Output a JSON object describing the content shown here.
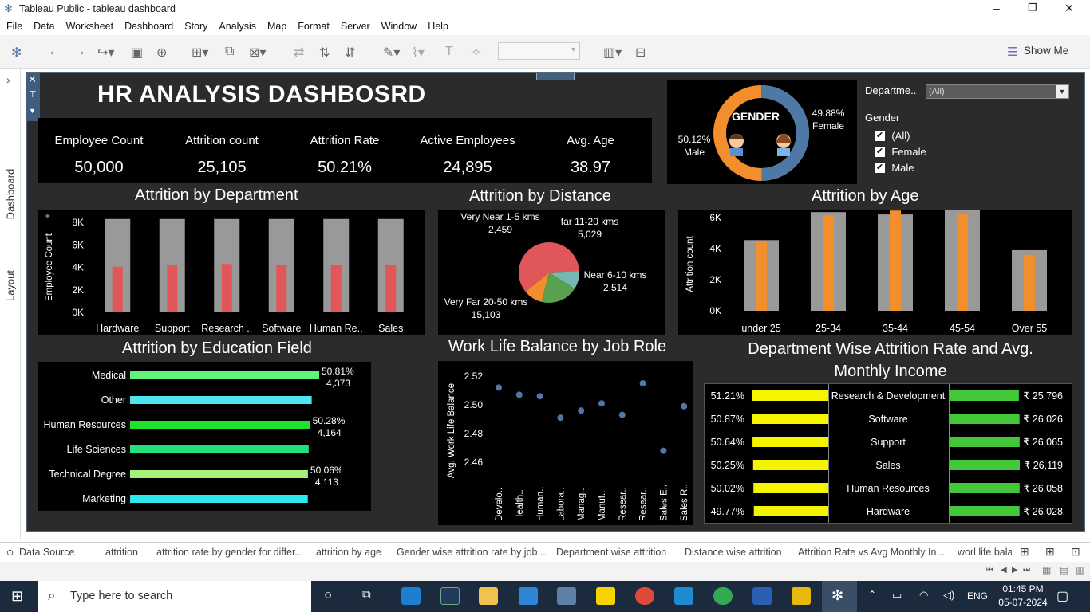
{
  "window": {
    "title": "Tableau Public - tableau dashboard",
    "controls": [
      "–",
      "❐",
      "✕"
    ]
  },
  "menu": [
    "File",
    "Data",
    "Worksheet",
    "Dashboard",
    "Story",
    "Analysis",
    "Map",
    "Format",
    "Server",
    "Window",
    "Help"
  ],
  "toolbar": {
    "show_me": "Show Me"
  },
  "side_tabs": [
    "Dashboard",
    "Layout"
  ],
  "dashboard": {
    "title": "HR ANALYSIS DASHBOSRD",
    "kpis": [
      {
        "label": "Employee Count",
        "value": "50,000"
      },
      {
        "label": "Attrition count",
        "value": "25,105"
      },
      {
        "label": "Attrition Rate",
        "value": "50.21%"
      },
      {
        "label": "Active Employees",
        "value": "24,895"
      },
      {
        "label": "Avg. Age",
        "value": "38.97"
      }
    ],
    "gender": {
      "center": "GENDER",
      "male_pct": "50.12%",
      "male_label": "Male",
      "female_pct": "49.88%",
      "female_label": "Female",
      "male_value": 50.12,
      "female_value": 49.88,
      "colors": {
        "male": "#f28e2b",
        "female": "#4e79a7"
      }
    },
    "filters": {
      "department_label": "Departme..",
      "department_value": "(All)",
      "gender_label": "Gender",
      "options": [
        "(All)",
        "Female",
        "Male"
      ],
      "checks": [
        true,
        true,
        true
      ]
    }
  },
  "chart_data": [
    {
      "id": "dept",
      "type": "bar",
      "title": "Attrition by Department",
      "ylabel": "Employee Count",
      "ylim": [
        0,
        8000
      ],
      "yticks": [
        "8K",
        "6K",
        "4K",
        "2K",
        "0K"
      ],
      "categories": [
        "Hardware",
        "Support",
        "Research ..",
        "Software",
        "Human Re..",
        "Sales"
      ],
      "series": [
        {
          "values": [
            8300,
            8300,
            8300,
            8300,
            8300,
            8300
          ]
        },
        {
          "values": [
            4050,
            4200,
            4300,
            4220,
            4200,
            4230
          ]
        }
      ],
      "colors": [
        "#999999",
        "#e15759"
      ]
    },
    {
      "id": "distance",
      "type": "pie",
      "title": "Attrition by Distance",
      "slices": [
        {
          "label": "Very Far 20-50 kms",
          "value": 15103,
          "text": "15,103",
          "color": "#e15759"
        },
        {
          "label": "Very Near 1-5 kms",
          "value": 2459,
          "text": "2,459",
          "color": "#76b7b2"
        },
        {
          "label": "far 11-20 kms",
          "value": 5029,
          "text": "5,029",
          "color": "#59a14f"
        },
        {
          "label": "Near 6-10 kms",
          "value": 2514,
          "text": "2,514",
          "color": "#f28e2b"
        }
      ]
    },
    {
      "id": "age",
      "type": "bar",
      "title": "Attrition by Age",
      "ylabel": "Attrition count",
      "ylim": [
        0,
        6000
      ],
      "yticks": [
        "6K",
        "4K",
        "2K",
        "0K"
      ],
      "categories": [
        "under 25",
        "25-34",
        "35-44",
        "45-54",
        "Over 55"
      ],
      "series": [
        {
          "values": [
            4550,
            6350,
            6200,
            6500,
            3900
          ]
        },
        {
          "values": [
            4450,
            6150,
            6450,
            6250,
            3600
          ]
        }
      ],
      "colors": [
        "#999999",
        "#f28e2b"
      ]
    },
    {
      "id": "education",
      "type": "bar",
      "orientation": "horizontal",
      "title": "Attrition by Education Field",
      "categories": [
        "Medical",
        "Other",
        "Human Resources",
        "Life Sciences",
        "Technical Degree",
        "Marketing"
      ],
      "values": [
        4373,
        4200,
        4164,
        4130,
        4113,
        4110
      ],
      "labels": [
        [
          "50.81%",
          "4,373"
        ],
        [
          "",
          ""
        ],
        [
          "50.28%",
          "4,164"
        ],
        [
          "",
          ""
        ],
        [
          "50.06%",
          "4,113"
        ],
        [
          "",
          ""
        ]
      ],
      "colors": [
        "#62f27a",
        "#4ce8f0",
        "#1fe32b",
        "#24e07a",
        "#a8f27a",
        "#2de8f0"
      ]
    },
    {
      "id": "wlb",
      "type": "scatter",
      "title": "Work Life Balance by Job Role",
      "ylabel": "Avg. Work Life Balance",
      "ylim": [
        2.45,
        2.525
      ],
      "yticks": [
        "2.52",
        "2.50",
        "2.48",
        "2.46"
      ],
      "categories": [
        "Develo..",
        "Health..",
        "Human..",
        "Labora..",
        "Manag..",
        "Manuf..",
        "Resear..",
        "Resear..",
        "Sales E..",
        "Sales R.."
      ],
      "values": [
        2.512,
        2.507,
        2.506,
        2.491,
        2.496,
        2.501,
        2.493,
        2.515,
        2.468,
        2.499
      ]
    },
    {
      "id": "dept_rate",
      "type": "table",
      "title": "Department Wise Attrition Rate and Avg. Monthly Income",
      "rows": [
        {
          "rate": "51.21%",
          "rate_value": 51.21,
          "dept": "Research & Development",
          "income": "₹ 25,796",
          "income_value": 25796
        },
        {
          "rate": "50.87%",
          "rate_value": 50.87,
          "dept": "Software",
          "income": "₹ 26,026",
          "income_value": 26026
        },
        {
          "rate": "50.64%",
          "rate_value": 50.64,
          "dept": "Support",
          "income": "₹ 26,065",
          "income_value": 26065
        },
        {
          "rate": "50.25%",
          "rate_value": 50.25,
          "dept": "Sales",
          "income": "₹ 26,119",
          "income_value": 26119
        },
        {
          "rate": "50.02%",
          "rate_value": 50.02,
          "dept": "Human Resources",
          "income": "₹ 26,058",
          "income_value": 26058
        },
        {
          "rate": "49.77%",
          "rate_value": 49.77,
          "dept": "Hardware",
          "income": "₹ 26,028",
          "income_value": 26028
        }
      ]
    }
  ],
  "tabs": [
    "Data Source",
    "attrition",
    "attrition rate by gender for differ...",
    "attrition by age",
    "Gender wise attrition rate by job ...",
    "Department wise attrition",
    "Distance wise attrition",
    "Attrition Rate vs Avg Monthly In...",
    "worl life bala"
  ],
  "taskbar": {
    "search": "Type here to search",
    "time": "01:45 PM",
    "date": "05-07-2024",
    "lang": "ENG"
  }
}
